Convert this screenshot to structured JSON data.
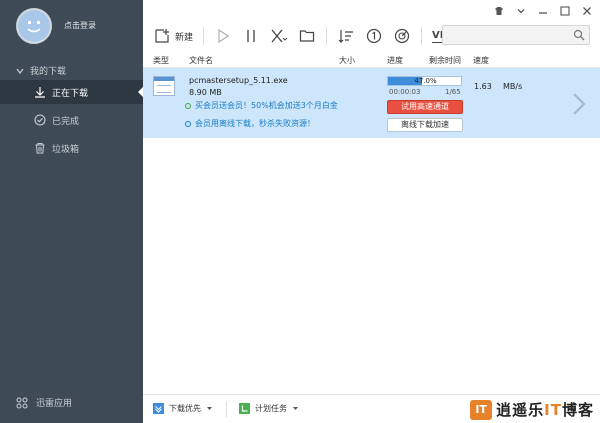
{
  "sidebar": {
    "login_label": "点击登录",
    "section_label": "我的下载",
    "items": [
      {
        "label": "正在下载",
        "icon": "download-arrow-icon"
      },
      {
        "label": "已完成",
        "icon": "check-circle-icon"
      },
      {
        "label": "垃圾箱",
        "icon": "trash-icon"
      }
    ],
    "apps_label": "迅雷应用"
  },
  "toolbar": {
    "new_label": "新建",
    "vip_label": "VIP"
  },
  "search": {
    "placeholder": ""
  },
  "columns": {
    "type": "类型",
    "filename": "文件名",
    "size": "大小",
    "progress": "进度",
    "remaining": "剩余时间",
    "speed": "速度"
  },
  "download": {
    "filename": "pcmastersetup_5.11.exe",
    "size": "8.90 MB",
    "progress_label": "47.0%",
    "progress_value": 47,
    "elapsed": "00:00:03",
    "count": "1/65",
    "speed": "1.63",
    "speed_unit": "MB/s",
    "promo1": "买会员送会员！50%机会加送3个月白金",
    "promo2": "会员用离线下载，秒杀失败资源！",
    "btn_fast": "试用高速通道",
    "btn_offline": "离线下载加速"
  },
  "bottombar": {
    "priority_label": "下载优先",
    "schedule_label": "计划任务"
  },
  "watermark": {
    "prefix": "逍遥乐",
    "mid": "IT",
    "suffix": "博客",
    "logo": "IT"
  },
  "colors": {
    "sidebar_bg": "#3e4a56",
    "row_highlight": "#cde6fb",
    "accent_blue": "#3d8ddb",
    "accent_red": "#e9503f",
    "watermark_orange": "#e8822a"
  }
}
